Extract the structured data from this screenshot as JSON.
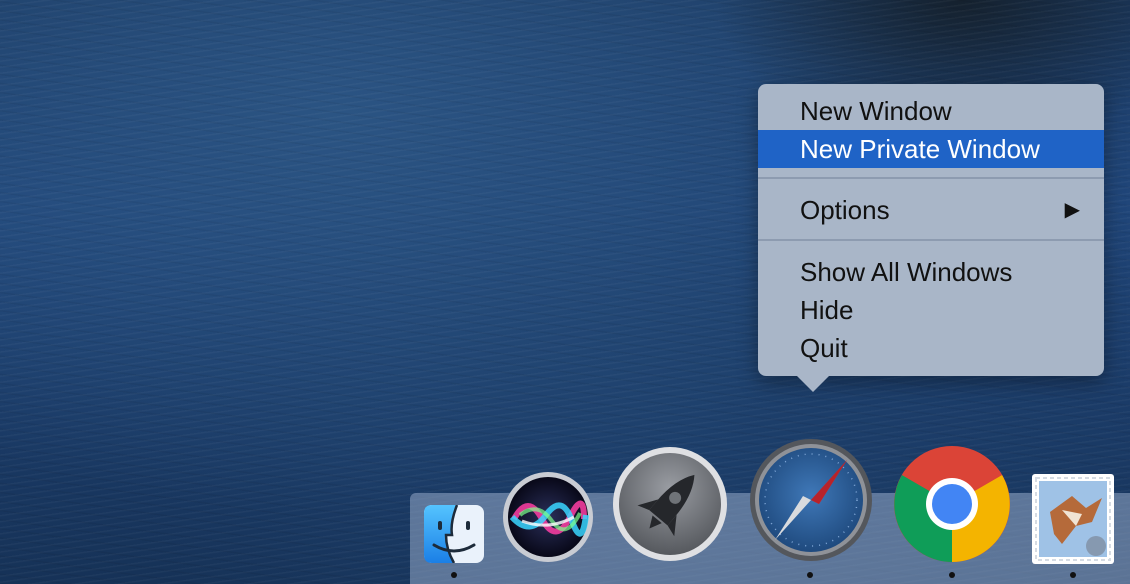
{
  "context_menu": {
    "items": [
      {
        "label": "New Window"
      },
      {
        "label": "New Private Window",
        "selected": true
      },
      {
        "label": "Options",
        "submenu_icon": "▶"
      },
      {
        "label": "Show All Windows"
      },
      {
        "label": "Hide"
      },
      {
        "label": "Quit"
      }
    ],
    "highlight_color": "#1f63c6"
  },
  "dock": {
    "apps": [
      {
        "icon": "finder-icon",
        "running": true
      },
      {
        "icon": "siri-icon",
        "running": false
      },
      {
        "icon": "launchpad-icon",
        "running": false
      },
      {
        "icon": "safari-icon",
        "running": true
      },
      {
        "icon": "chrome-icon",
        "running": true
      },
      {
        "icon": "mail-icon",
        "running": true
      }
    ]
  }
}
